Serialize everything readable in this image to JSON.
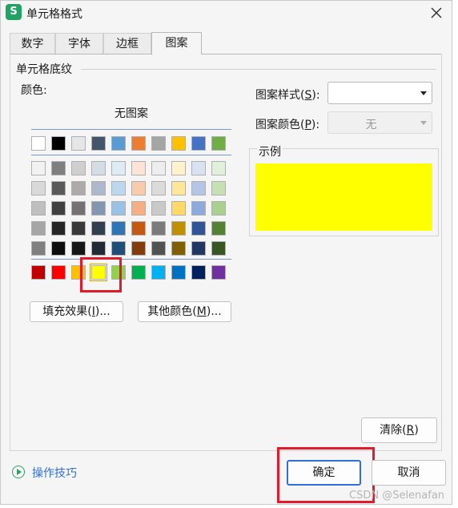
{
  "window": {
    "title": "单元格格式",
    "app_icon_letter": "S"
  },
  "tabs": [
    {
      "label": "数字",
      "active": false
    },
    {
      "label": "字体",
      "active": false
    },
    {
      "label": "边框",
      "active": false
    },
    {
      "label": "图案",
      "active": true
    }
  ],
  "shading": {
    "section_title": "单元格底纹",
    "color_label": "颜色:",
    "no_pattern_label": "无图案",
    "selected_color": "#FFFF00",
    "palette": {
      "row0": [
        "#FFFFFF",
        "#000000",
        "#E7E6E6",
        "#44546A",
        "#5B9BD5",
        "#ED7D31",
        "#A5A5A5",
        "#FFC000",
        "#4472C4",
        "#70AD47"
      ],
      "tints": [
        [
          "#F2F2F2",
          "#7F7F7F",
          "#D0CECE",
          "#D6DCE4",
          "#DDEBF7",
          "#FCE4D6",
          "#EDEDED",
          "#FFF2CC",
          "#D9E1F2",
          "#E2EFDA"
        ],
        [
          "#D9D9D9",
          "#595959",
          "#AEAAAA",
          "#ADB9CA",
          "#BDD7EE",
          "#F8CBAD",
          "#DBDBDB",
          "#FFE699",
          "#B4C6E7",
          "#C6E0B4"
        ],
        [
          "#BFBFBF",
          "#404040",
          "#757171",
          "#8497B0",
          "#9BC2E6",
          "#F4B084",
          "#C9C9C9",
          "#FFD966",
          "#8EA9DB",
          "#A9D08E"
        ],
        [
          "#A6A6A6",
          "#262626",
          "#3A3838",
          "#333F4F",
          "#2F75B5",
          "#C65911",
          "#7B7B7B",
          "#BF8F00",
          "#305496",
          "#548235"
        ],
        [
          "#808080",
          "#0D0D0D",
          "#161616",
          "#222B35",
          "#1F4E78",
          "#833C0C",
          "#525252",
          "#806000",
          "#203764",
          "#375623"
        ]
      ],
      "standard": [
        "#C00000",
        "#FF0000",
        "#FFC000",
        "#FFFF00",
        "#92D050",
        "#00B050",
        "#00B0F0",
        "#0070C0",
        "#002060",
        "#7030A0"
      ]
    },
    "fill_effects_button": {
      "text": "填充效果(",
      "key": "I",
      "suffix": ")..."
    },
    "more_colors_button": {
      "text": "其他颜色(",
      "key": "M",
      "suffix": ")..."
    }
  },
  "pattern_style": {
    "text": "图案样式(",
    "key": "S",
    "suffix": "):",
    "value": ""
  },
  "pattern_color": {
    "text": "图案颜色(",
    "key": "P",
    "suffix": "):",
    "value": "无"
  },
  "sample": {
    "label": "示例",
    "color": "#FFFF00"
  },
  "clear_button": {
    "text": "清除(",
    "key": "R",
    "suffix": ")"
  },
  "tips_link": "操作技巧",
  "ok_button": "确定",
  "cancel_button": "取消",
  "watermark": "CSDN @Selenafan",
  "accent_color": "#2F6FD8",
  "highlight_color": "#E11B2A"
}
